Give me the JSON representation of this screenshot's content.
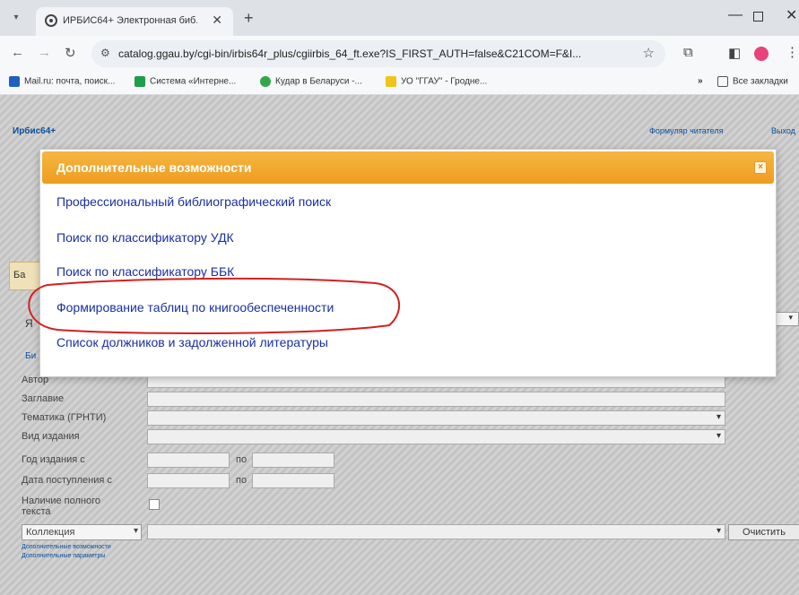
{
  "browser": {
    "tab_title": "ИРБИС64+ Электронная биб...",
    "tab_dropdown": "▾",
    "tab_close": "✕",
    "new_tab": "+",
    "url": "catalog.ggau.by/cgi-bin/irbis64r_plus/cgiirbis_64_ft.exe?IS_FIRST_AUTH=false&C21COM=F&I...",
    "window_min": "—",
    "window_close": "✕",
    "bookmarks": [
      {
        "label": "Mail.ru: почта, поиск...",
        "color": "#1f5fbf"
      },
      {
        "label": "Система «Интерне...",
        "color": "#1e9e4a"
      },
      {
        "label": "Кудар в Беларуси -...",
        "color": "#2fa84a"
      },
      {
        "label": "УО \"ГГАУ\" - Гродне...",
        "color": "#f0c419"
      }
    ],
    "bookmarks_more": "»",
    "bookmarks_all": "Все закладки"
  },
  "page": {
    "logo": "Ирбис64+",
    "link_reader": "Формуляр читателя",
    "link_exit": "Выход",
    "tab_label": "Ба",
    "letter_ya": "Я",
    "letter_bi": "Би",
    "form": {
      "author_label": "Автор",
      "title_label": "Заглавие",
      "topic_label": "Тематика (ГРНТИ)",
      "type_label": "Вид издания",
      "year_label": "Год издания с",
      "year_to": "по",
      "date_label": "Дата поступления с",
      "date_to": "по",
      "fulltext_label_1": "Наличие полного",
      "fulltext_label_2": "текста",
      "collection_select": "Коллекция",
      "clear_button": "Очистить",
      "link_extra": "Дополнительные возможности",
      "link_params": "Дополнительные параметры"
    }
  },
  "modal": {
    "title": "Дополнительные возможности",
    "close": "×",
    "items": [
      "Профессиональный библиографический поиск",
      "Поиск по классификатору УДК",
      "Поиск по классификатору ББК",
      "Формирование таблиц по книгообеспеченности",
      "Список должников и задолженной литературы"
    ],
    "header_color": "#f0a12a",
    "link_color": "#1a2fa2",
    "highlight_color": "#d32020"
  }
}
